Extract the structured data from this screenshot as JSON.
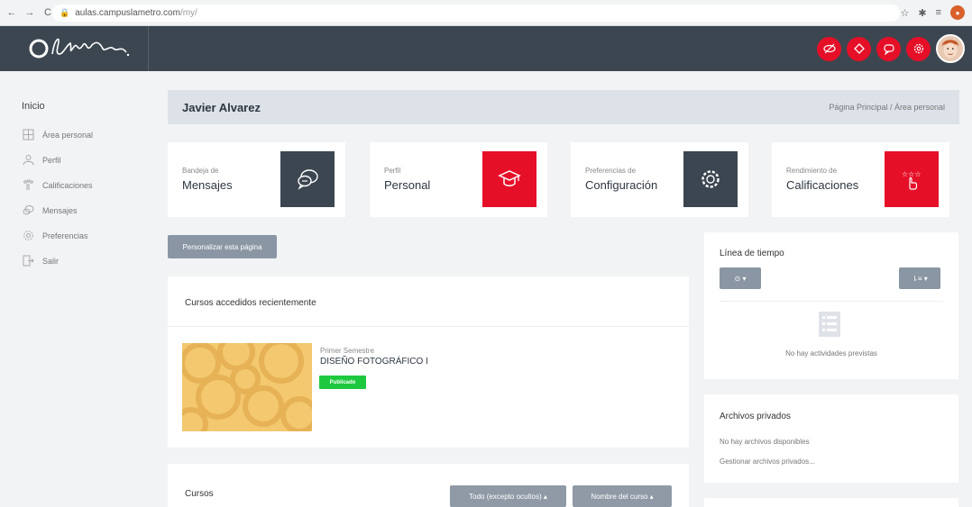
{
  "browser": {
    "url_host": "aulas.campuslametro.com",
    "url_path": "/my/"
  },
  "app": {
    "logo_text": "OlaMetro"
  },
  "sidebar": {
    "title": "Inicio",
    "items": [
      {
        "label": "Área personal",
        "icon": "dashboard-icon"
      },
      {
        "label": "Perfil",
        "icon": "user-icon"
      },
      {
        "label": "Calificaciones",
        "icon": "grades-icon"
      },
      {
        "label": "Mensajes",
        "icon": "messages-icon"
      },
      {
        "label": "Preferencias",
        "icon": "gear-icon"
      },
      {
        "label": "Salir",
        "icon": "logout-icon"
      }
    ]
  },
  "page_header": {
    "user_name": "Javier Alvarez",
    "breadcrumb": "Página Principal / Área personal"
  },
  "tiles": [
    {
      "small": "Bandeja de",
      "big": "Mensajes",
      "icon": "chat-bubbles-icon"
    },
    {
      "small": "Perfil",
      "big": "Personal",
      "icon": "graduation-cap-icon"
    },
    {
      "small": "Preferencias de",
      "big": "Configuración",
      "icon": "gear-icon"
    },
    {
      "small": "Rendimiento de",
      "big": "Calificaciones",
      "icon": "stars-hand-icon"
    }
  ],
  "customize_button": "Personalizar esta página",
  "recent_courses": {
    "title": "Cursos accedidos recientemente",
    "course_category": "Primer Semestre",
    "course_name": "DISEÑO FOTOGRÁFICO I",
    "badge": "Publicado"
  },
  "courses": {
    "title": "Cursos",
    "filter_button": "Todo (excepto ocultos) ▴",
    "sort_button": "Nombre del curso ▴"
  },
  "timeline": {
    "title": "Línea de tiempo",
    "empty_text": "No hay actividades previstas"
  },
  "private_files": {
    "title": "Archivos privados",
    "empty_text": "No hay archivos disponibles",
    "manage_link": "Gestionar archivos privados..."
  },
  "colors": {
    "header_bg": "#3c4650",
    "accent_red": "#e60f28",
    "badge_green": "#1ec83e"
  }
}
